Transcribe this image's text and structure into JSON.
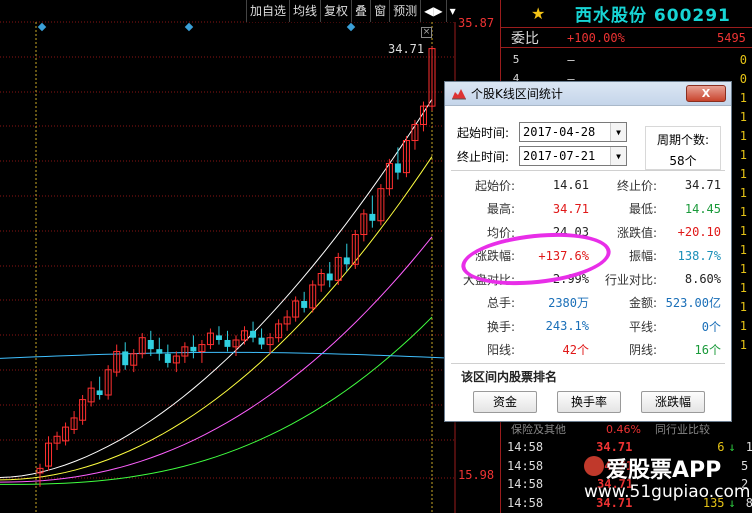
{
  "toolbar": {
    "items": [
      "加自选",
      "均线",
      "复权",
      "叠",
      "窗",
      "预测",
      "◀▶",
      "▾"
    ]
  },
  "chart": {
    "price_high_axis": "35.87",
    "price_low_axis": "15.98",
    "last_price_tag": "34.71",
    "close_mark": "×",
    "colors": {
      "up": "#ff3030",
      "down": "#30d0e0",
      "ma5": "#ffffff",
      "ma10": "#ffff40",
      "ma20": "#ff60ff",
      "ma60": "#40ff40",
      "ma120": "#40c0ff",
      "dashed": "#c8a828"
    },
    "candles": [
      [
        16.2,
        16.6,
        15.6,
        16.4
      ],
      [
        16.5,
        17.8,
        16.3,
        17.5
      ],
      [
        17.5,
        18.0,
        17.2,
        17.8
      ],
      [
        17.6,
        18.4,
        17.4,
        18.2
      ],
      [
        18.1,
        18.9,
        17.9,
        18.6
      ],
      [
        18.5,
        19.6,
        18.3,
        19.4
      ],
      [
        19.3,
        20.2,
        19.1,
        19.9
      ],
      [
        19.8,
        20.4,
        19.4,
        19.6
      ],
      [
        19.6,
        20.9,
        19.4,
        20.7
      ],
      [
        20.6,
        21.8,
        20.4,
        21.5
      ],
      [
        21.5,
        21.9,
        20.7,
        20.9
      ],
      [
        20.9,
        21.6,
        20.6,
        21.4
      ],
      [
        21.4,
        22.3,
        21.2,
        22.1
      ],
      [
        22.0,
        22.4,
        21.3,
        21.6
      ],
      [
        21.6,
        22.1,
        21.1,
        21.4
      ],
      [
        21.4,
        21.8,
        20.8,
        21.0
      ],
      [
        21.0,
        21.5,
        20.6,
        21.3
      ],
      [
        21.3,
        21.9,
        21.0,
        21.7
      ],
      [
        21.7,
        22.2,
        21.2,
        21.5
      ],
      [
        21.5,
        22.0,
        21.0,
        21.8
      ],
      [
        21.8,
        22.5,
        21.6,
        22.3
      ],
      [
        22.2,
        22.6,
        21.8,
        22.0
      ],
      [
        22.0,
        22.4,
        21.5,
        21.7
      ],
      [
        21.7,
        22.2,
        21.3,
        22.0
      ],
      [
        22.0,
        22.6,
        21.8,
        22.4
      ],
      [
        22.4,
        22.8,
        21.9,
        22.1
      ],
      [
        22.1,
        22.5,
        21.6,
        21.8
      ],
      [
        21.8,
        22.3,
        21.4,
        22.1
      ],
      [
        22.1,
        22.9,
        21.9,
        22.7
      ],
      [
        22.7,
        23.3,
        22.4,
        23.0
      ],
      [
        23.0,
        23.9,
        22.8,
        23.7
      ],
      [
        23.7,
        24.1,
        23.2,
        23.4
      ],
      [
        23.4,
        24.6,
        23.2,
        24.4
      ],
      [
        24.4,
        25.1,
        24.1,
        24.9
      ],
      [
        24.9,
        25.4,
        24.3,
        24.6
      ],
      [
        24.6,
        25.8,
        24.4,
        25.6
      ],
      [
        25.6,
        26.2,
        25.0,
        25.3
      ],
      [
        25.3,
        26.8,
        25.1,
        26.6
      ],
      [
        26.6,
        27.7,
        26.3,
        27.5
      ],
      [
        27.5,
        28.3,
        26.9,
        27.2
      ],
      [
        27.2,
        28.8,
        27.0,
        28.6
      ],
      [
        28.6,
        29.9,
        28.3,
        29.7
      ],
      [
        29.7,
        30.4,
        29.0,
        29.3
      ],
      [
        29.3,
        30.9,
        29.1,
        30.7
      ],
      [
        30.7,
        31.6,
        30.3,
        31.4
      ],
      [
        31.4,
        32.4,
        31.1,
        32.2
      ],
      [
        32.2,
        34.8,
        32.0,
        34.71
      ]
    ],
    "ma_levels": {
      "ma5_start": 16.0,
      "ma5_end": 32.5,
      "ma10_start": 15.9,
      "ma10_end": 30.0,
      "ma20_start": 15.8,
      "ma20_end": 26.5,
      "ma60_start": 15.7,
      "ma60_end": 23.0,
      "ma120_level": 21.2
    }
  },
  "right_panel": {
    "star": "★",
    "stock_name": "西水股份 600291",
    "weibi_label": "委比",
    "weibi_value": "+100.00%",
    "weibi_num": "5495",
    "book": [
      {
        "level": "5",
        "price": "—",
        "vol": "0"
      },
      {
        "level": "4",
        "price": "—",
        "vol": "0"
      },
      {
        "level": "",
        "price": "",
        "vol": "1"
      },
      {
        "level": "",
        "price": "",
        "vol": "1"
      },
      {
        "level": "",
        "price": "",
        "vol": "1"
      },
      {
        "level": "",
        "price": "",
        "vol": "1"
      },
      {
        "level": "",
        "price": "",
        "vol": "1"
      },
      {
        "level": "",
        "price": "",
        "vol": "1"
      },
      {
        "level": "",
        "price": "",
        "vol": "1"
      },
      {
        "level": "",
        "price": "",
        "vol": "1"
      },
      {
        "level": "",
        "price": "",
        "vol": "1"
      },
      {
        "level": "",
        "price": "",
        "vol": "1"
      },
      {
        "level": "",
        "price": "",
        "vol": "1"
      },
      {
        "level": "",
        "price": "",
        "vol": "1"
      },
      {
        "level": "",
        "price": "",
        "vol": "1"
      },
      {
        "level": "",
        "price": "",
        "vol": "1"
      }
    ],
    "sector_left": "保险及其他",
    "sector_mid": "0.46%",
    "sector_right": "同行业比较",
    "ticks": [
      {
        "time": "14:58",
        "price": "34.71",
        "vol": "6",
        "arrow": "↓",
        "n": "1"
      },
      {
        "time": "14:58",
        "price": "34.71",
        "vol": "",
        "arrow": "",
        "n": "5"
      },
      {
        "time": "14:58",
        "price": "34.71",
        "vol": "",
        "arrow": "",
        "n": "2"
      },
      {
        "time": "14:58",
        "price": "34.71",
        "vol": "135",
        "arrow": "↓",
        "n": "8"
      }
    ],
    "watermark_text": "爱股票APP",
    "watermark_url": "www.51gupiao.com"
  },
  "dialog": {
    "title": "个股K线区间统计",
    "close_label": "X",
    "start_label": "起始时间:",
    "start_date": "2017-04-28",
    "end_label": "终止时间:",
    "end_date": "2017-07-21",
    "period_label": "周期个数:",
    "period_value": "58个",
    "rows": [
      {
        "k1": "起始价:",
        "v1": "14.61",
        "c1": "c-black",
        "k2": "终止价:",
        "v2": "34.71",
        "c2": "c-black"
      },
      {
        "k1": "最高:",
        "v1": "34.71",
        "c1": "c-red",
        "k2": "最低:",
        "v2": "14.45",
        "c2": "c-green"
      },
      {
        "k1": "均价:",
        "v1": "24.03",
        "c1": "c-black",
        "k2": "涨跌值:",
        "v2": "+20.10",
        "c2": "c-red"
      },
      {
        "k1": "涨跌幅:",
        "v1": "+137.6%",
        "c1": "c-red",
        "k2": "振幅:",
        "v2": "138.7%",
        "c2": "c-teal"
      },
      {
        "k1": "大盘对比:",
        "v1": "2.99%",
        "c1": "c-black",
        "k2": "行业对比:",
        "v2": "8.60%",
        "c2": "c-black"
      },
      {
        "k1": "总手:",
        "v1": "2380万",
        "c1": "c-blue",
        "k2": "金额:",
        "v2": "523.00亿",
        "c2": "c-blue"
      },
      {
        "k1": "换手:",
        "v1": "243.1%",
        "c1": "c-blue",
        "k2": "平线:",
        "v2": "0个",
        "c2": "c-blue"
      },
      {
        "k1": "阳线:",
        "v1": "42个",
        "c1": "c-red",
        "k2": "阴线:",
        "v2": "16个",
        "c2": "c-green"
      }
    ],
    "rank_title": "该区间内股票排名",
    "buttons": [
      "资金",
      "换手率",
      "涨跌幅"
    ]
  }
}
